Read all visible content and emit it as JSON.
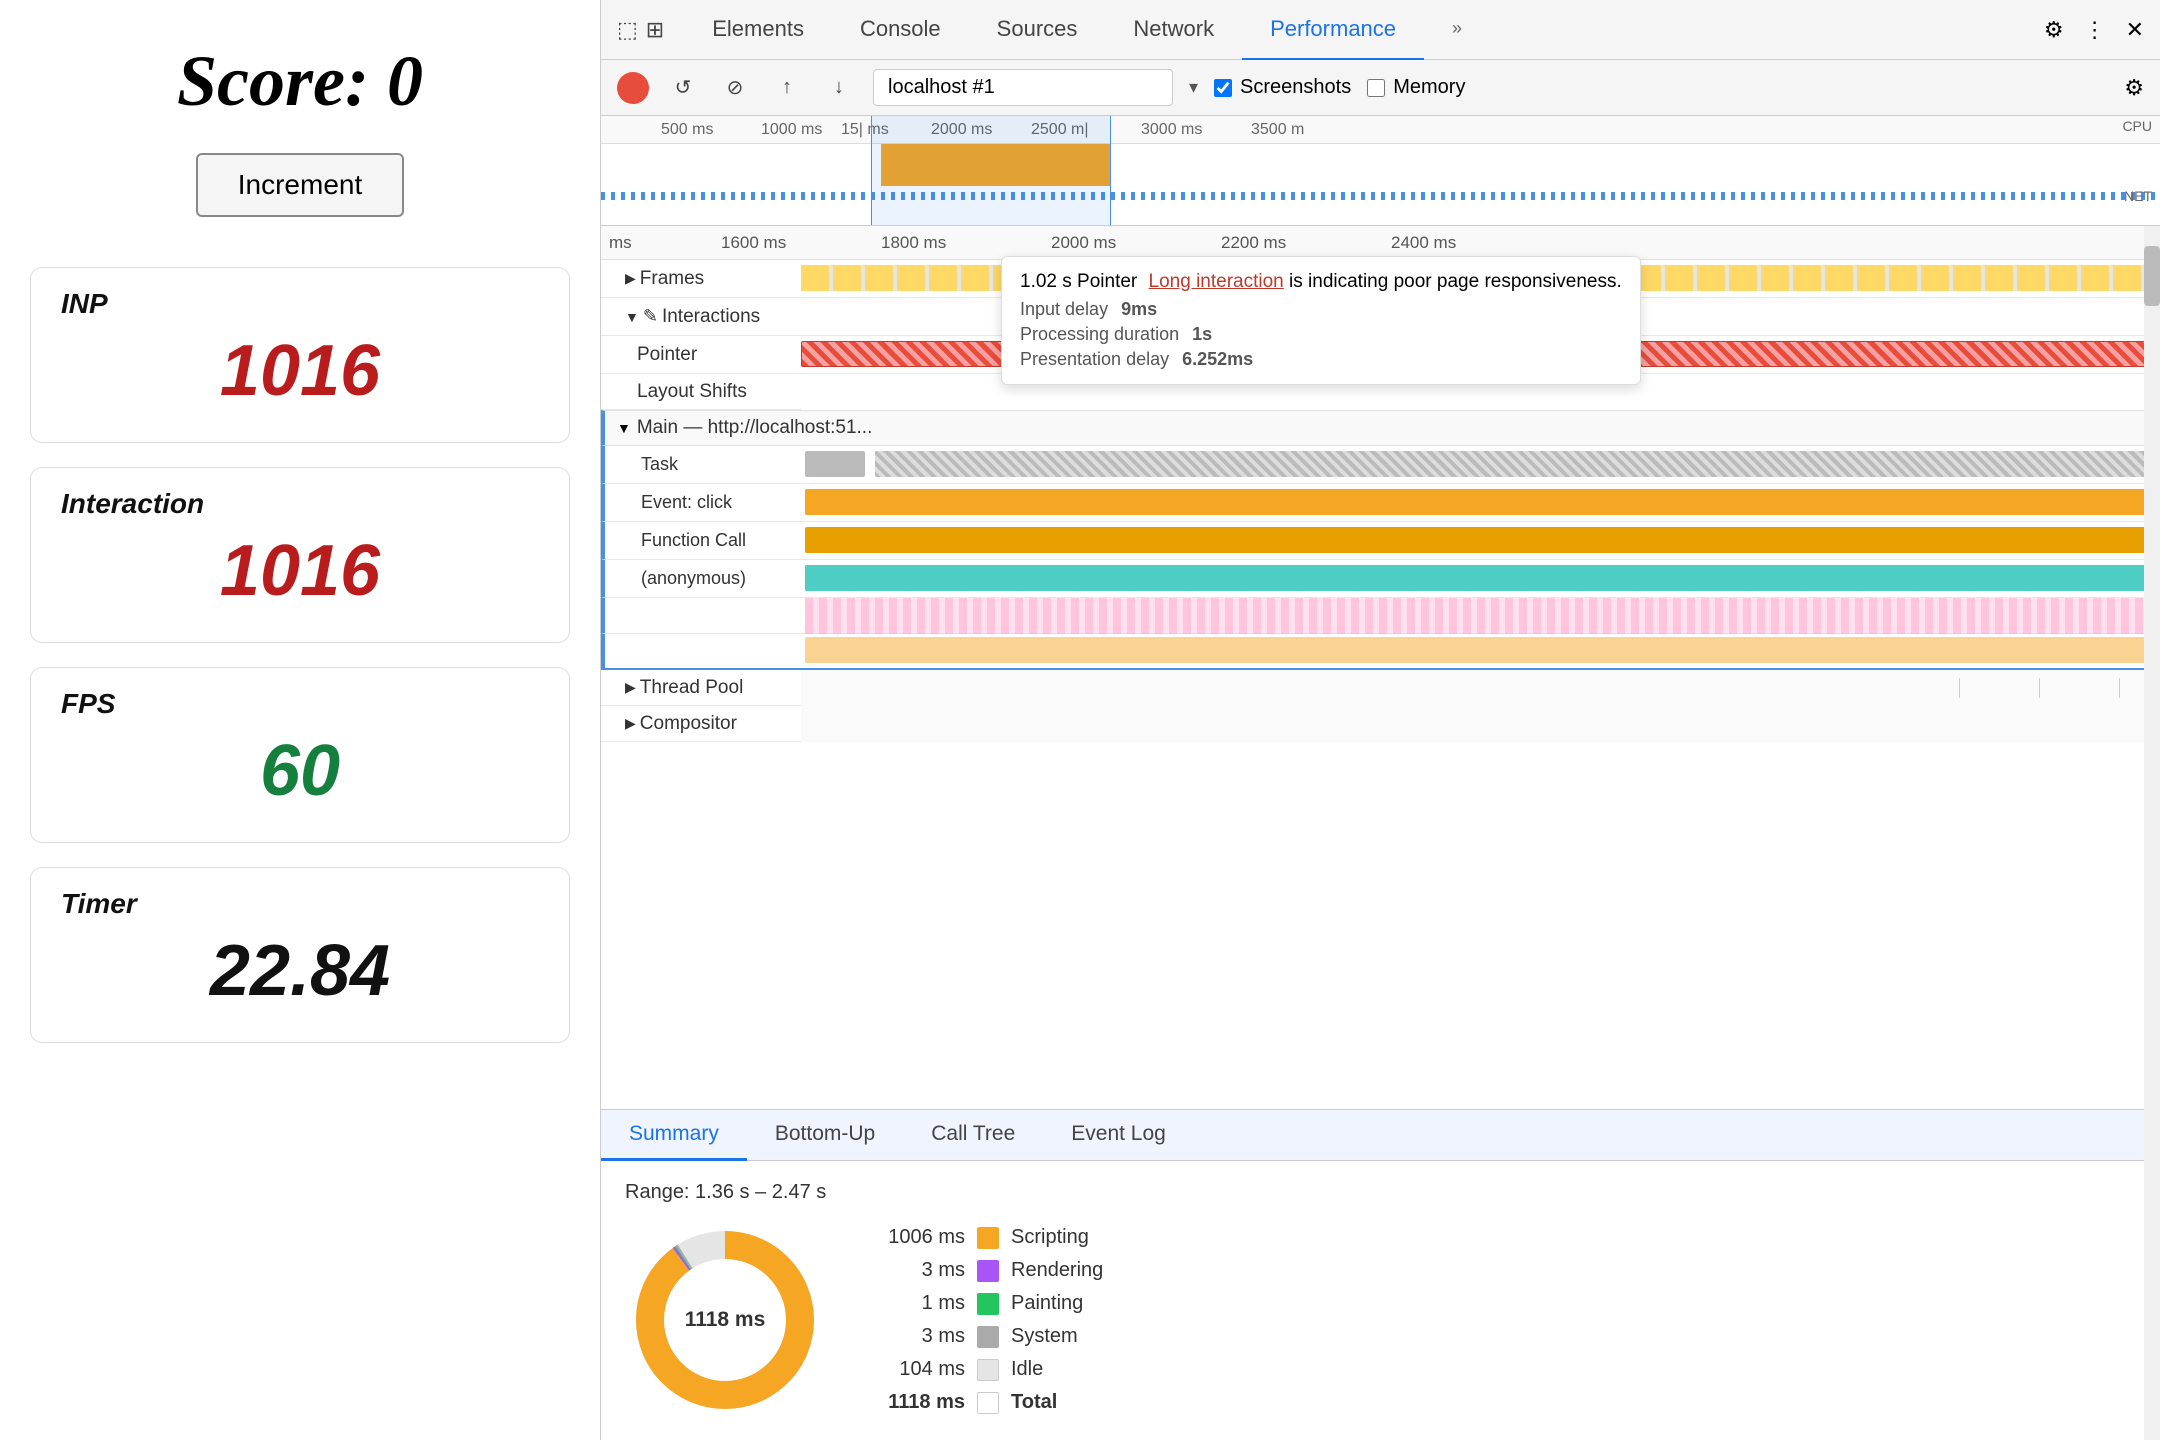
{
  "left": {
    "score_label": "Score: 0",
    "increment_btn": "Increment",
    "metrics": [
      {
        "label": "INP",
        "value": "1016",
        "color": "red"
      },
      {
        "label": "Interaction",
        "value": "1016",
        "color": "red"
      },
      {
        "label": "FPS",
        "value": "60",
        "color": "green"
      },
      {
        "label": "Timer",
        "value": "22.84",
        "color": "black"
      }
    ]
  },
  "devtools": {
    "tabs": [
      "Elements",
      "Console",
      "Sources",
      "Network",
      "Performance"
    ],
    "active_tab": "Performance",
    "toolbar": {
      "url": "localhost #1",
      "screenshots_label": "Screenshots",
      "memory_label": "Memory"
    },
    "timeline": {
      "ruler_ticks": [
        "500 ms",
        "1000 ms",
        "15| ms",
        "2000 ms",
        "2500 m|",
        "3000 ms",
        "3500 m"
      ],
      "ruler2_ticks": [
        "ms",
        "1600 ms",
        "1800 ms",
        "2000 ms",
        "2200 ms",
        "2400 ms"
      ]
    },
    "tracks": {
      "frames_label": "Frames",
      "interactions_label": "Interactions",
      "pointer_label": "Pointer",
      "layout_shifts_label": "Layout Shifts",
      "main_label": "Main — http://localhost:51...",
      "task_label": "Task",
      "event_click_label": "Event: click",
      "function_call_label": "Function Call",
      "anonymous_label": "(anonymous)",
      "thread_pool_label": "Thread Pool",
      "compositor_label": "Compositor"
    },
    "tooltip": {
      "time": "1.02 s",
      "type": "Pointer",
      "link_text": "Long interaction",
      "message": "is indicating poor page responsiveness.",
      "input_delay_label": "Input delay",
      "input_delay_value": "9ms",
      "processing_label": "Processing duration",
      "processing_value": "1s",
      "presentation_label": "Presentation delay",
      "presentation_value": "6.252ms"
    },
    "bottom_tabs": [
      "Summary",
      "Bottom-Up",
      "Call Tree",
      "Event Log"
    ],
    "active_bottom_tab": "Summary",
    "summary": {
      "range": "Range: 1.36 s – 2.47 s",
      "donut_label": "1118 ms",
      "legend": [
        {
          "value": "1006 ms",
          "color": "#f5a623",
          "label": "Scripting"
        },
        {
          "value": "3 ms",
          "color": "#a855f7",
          "label": "Rendering"
        },
        {
          "value": "1 ms",
          "color": "#22c55e",
          "label": "Painting"
        },
        {
          "value": "3 ms",
          "color": "#aaa",
          "label": "System"
        },
        {
          "value": "104 ms",
          "color": "#e5e5e5",
          "label": "Idle"
        },
        {
          "value": "1118 ms",
          "color": "#fff",
          "label": "Total"
        }
      ]
    }
  }
}
